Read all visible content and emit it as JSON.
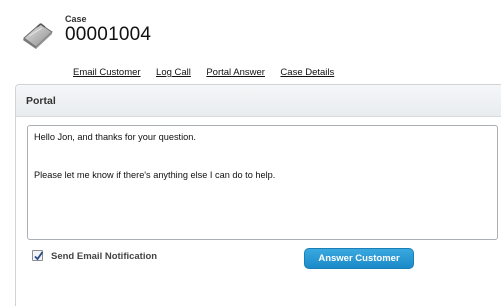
{
  "header": {
    "object_label": "Case",
    "record_number": "00001004",
    "icon": "case-briefcase-icon"
  },
  "tabs": [
    {
      "label": "Email Customer"
    },
    {
      "label": "Log Call"
    },
    {
      "label": "Portal Answer"
    },
    {
      "label": "Case Details"
    }
  ],
  "panel": {
    "title": "Portal",
    "message_lines": [
      "Hello Jon, and thanks for your question.",
      "Please let me know if there's anything else I can do to help."
    ],
    "send_email_notification": {
      "label": "Send Email Notification",
      "checked": true
    },
    "answer_button_label": "Answer Customer"
  },
  "colors": {
    "button_blue": "#1a8ac8",
    "panel_header_bg": "#eceff2"
  }
}
